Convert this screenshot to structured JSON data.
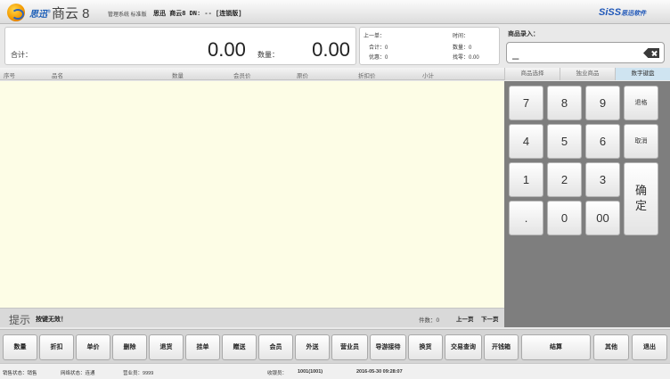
{
  "title": {
    "brand": "思迅",
    "brand_sup": "®",
    "product": "商云 8",
    "edition": "管理系统 标准版",
    "dn_info": "思迅 商云8 DN: -- [连锁版]",
    "siss": "SiSS",
    "siss_suffix": "思迅软件"
  },
  "summary": {
    "total_label": "合计：",
    "total_amount": "0.00",
    "qty_label": "数量：",
    "qty_value": "0.00"
  },
  "last_order": {
    "title": "上一单：",
    "total": "合计：0",
    "discount": "优惠：0",
    "time_label": "时间：",
    "qty": "数量：0",
    "change": "找零：0.00"
  },
  "entry": {
    "label": "商品录入：",
    "value": "_"
  },
  "table": {
    "columns": [
      "序号",
      "品名",
      "数量",
      "会员价",
      "原价",
      "折扣价",
      "小计"
    ]
  },
  "tabs": [
    "商品选择",
    "独业商品",
    "数字键盘"
  ],
  "hint": {
    "label": "提示",
    "text": "按键无效！",
    "count": "件数：0",
    "prev": "上一页",
    "next": "下一页"
  },
  "keypad": {
    "k7": "7",
    "k8": "8",
    "k9": "9",
    "back": "退格",
    "k4": "4",
    "k5": "5",
    "k6": "6",
    "cancel": "取消",
    "k1": "1",
    "k2": "2",
    "k3": "3",
    "confirm1": "确",
    "confirm2": "定",
    "dot": ".",
    "k0": "0",
    "k00": "00"
  },
  "buttons": [
    "数量",
    "折扣",
    "单价",
    "删除",
    "退货",
    "挂单",
    "赠送",
    "会员",
    "外送",
    "营业员",
    "导游接待",
    "换货",
    "交易查询",
    "开钱箱",
    "结算",
    "其他",
    "退出"
  ],
  "status": {
    "sale_label": "销售状态：",
    "sale_value": "销售",
    "net_label": "网络状态：",
    "net_value": "连通",
    "clerk_label": "营业员：",
    "clerk_value": "9999",
    "cashier_label": "收银员：",
    "cashier_value": "1001(1001)",
    "datetime": "2016-05-30 09:28:07"
  },
  "colors": {
    "accent": "#1e56b8",
    "table_bg": "#fdfde6",
    "keypad_bg": "#7e7e7e",
    "active_tab": "#cfe4f1"
  },
  "icons": [
    "logo-icon",
    "backspace-icon"
  ]
}
